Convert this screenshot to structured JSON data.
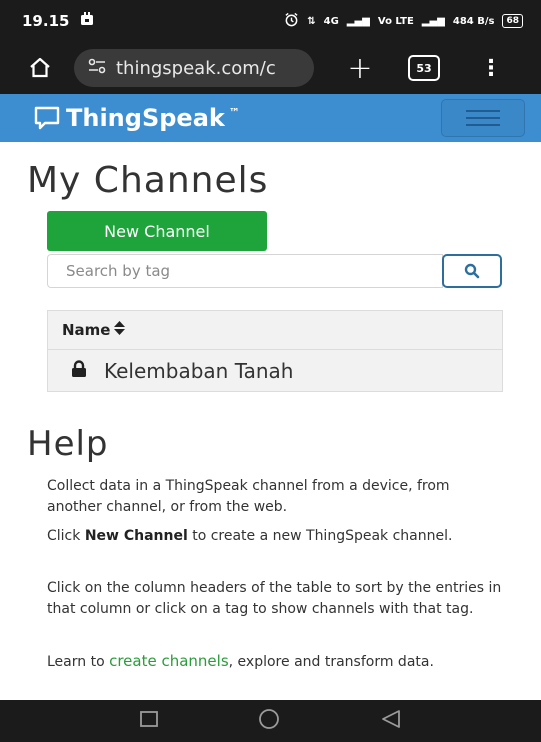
{
  "status_bar": {
    "time": "19.15",
    "network_a": "4G",
    "network_b": "Vo LTE",
    "speed": "484 B/s",
    "battery": "68"
  },
  "browser": {
    "url": "thingspeak.com/c",
    "tab_count": "53"
  },
  "navbar": {
    "brand": "ThingSpeak",
    "brand_tm": "™"
  },
  "main": {
    "title": "My Channels",
    "new_channel_label": "New Channel",
    "search_placeholder": "Search by tag",
    "table": {
      "header_name": "Name",
      "sort_glyph": "⇕",
      "rows": [
        {
          "name": "Kelembaban Tanah"
        }
      ]
    }
  },
  "help": {
    "title": "Help",
    "p1": "Collect data in a ThingSpeak channel from a device, from another channel, or from the web.",
    "p2_pre": "Click ",
    "p2_bold": "New Channel",
    "p2_post": " to create a new ThingSpeak channel.",
    "p3": "Click on the column headers of the table to sort by the entries in that column or click on a tag to show channels with that tag.",
    "p4_pre": "Learn to ",
    "p4_link": "create channels",
    "p4_post": ", explore and transform data."
  },
  "colors": {
    "navbar": "#3d8ed0",
    "new_channel_button": "#1fa43b",
    "link": "#2a9d3a"
  }
}
